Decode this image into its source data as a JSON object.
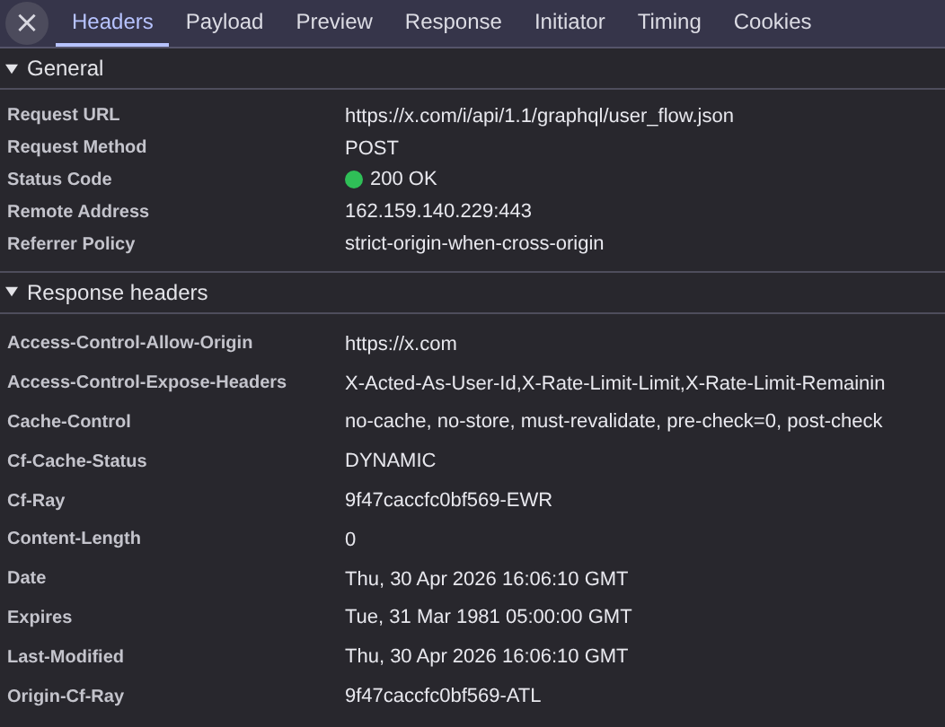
{
  "toolbar": {
    "close": "×"
  },
  "tabs": [
    {
      "label": "Headers",
      "selected": true
    },
    {
      "label": "Payload",
      "selected": false
    },
    {
      "label": "Preview",
      "selected": false
    },
    {
      "label": "Response",
      "selected": false
    },
    {
      "label": "Initiator",
      "selected": false
    },
    {
      "label": "Timing",
      "selected": false
    },
    {
      "label": "Cookies",
      "selected": false
    }
  ],
  "sections": [
    {
      "title": "General",
      "expanded": true,
      "rows": [
        {
          "kind": "text",
          "name": "Request URL",
          "value": "https://x.com/i/api/1.1/graphql/user_flow.json"
        },
        {
          "kind": "text",
          "name": "Request Method",
          "value": "POST"
        },
        {
          "kind": "status",
          "name": "Status Code",
          "value": "200 OK",
          "color": "#2fbf57"
        },
        {
          "kind": "text",
          "name": "Remote Address",
          "value": "162.159.140.229:443"
        },
        {
          "kind": "text",
          "name": "Referrer Policy",
          "value": "strict-origin-when-cross-origin"
        }
      ]
    },
    {
      "title": "Response headers",
      "expanded": true,
      "rows": [
        {
          "kind": "text",
          "name": "Access-Control-Allow-Origin",
          "value": "https://x.com"
        },
        {
          "kind": "text",
          "name": "Access-Control-Expose-Headers",
          "value": "X-Acted-As-User-Id,X-Rate-Limit-Limit,X-Rate-Limit-Remainin"
        },
        {
          "kind": "text",
          "name": "Cache-Control",
          "value": "no-cache, no-store, must-revalidate, pre-check=0, post-check"
        },
        {
          "kind": "text",
          "name": "Cf-Cache-Status",
          "value": "DYNAMIC"
        },
        {
          "kind": "text",
          "name": "Cf-Ray",
          "value": "9f47caccfc0bf569-EWR"
        },
        {
          "kind": "text",
          "name": "Content-Length",
          "value": "0"
        },
        {
          "kind": "text",
          "name": "Date",
          "value": "Thu, 30 Apr 2026 16:06:10 GMT"
        },
        {
          "kind": "text",
          "name": "Expires",
          "value": "Tue, 31 Mar 1981 05:00:00 GMT"
        },
        {
          "kind": "text",
          "name": "Last-Modified",
          "value": "Thu, 30 Apr 2026 16:06:10 GMT"
        },
        {
          "kind": "text",
          "name": "Origin-Cf-Ray",
          "value": "9f47caccfc0bf569-ATL"
        }
      ]
    }
  ]
}
